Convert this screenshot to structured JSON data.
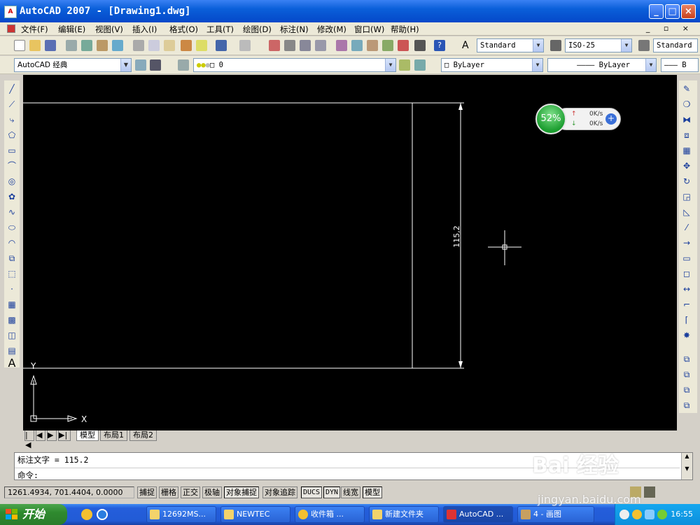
{
  "window": {
    "title": "AutoCAD 2007 - [Drawing1.dwg]",
    "app_icon": "A",
    "minimize": "_",
    "maximize": "□",
    "close": "×"
  },
  "menu": {
    "items": [
      "文件(F)",
      "编辑(E)",
      "视图(V)",
      "插入(I)",
      "格式(O)",
      "工具(T)",
      "绘图(D)",
      "标注(N)",
      "修改(M)",
      "窗口(W)",
      "帮助(H)"
    ],
    "mdi_controls": "_ ▫ ×"
  },
  "toolbar_styles": {
    "text_style": "Standard",
    "dim_style": "ISO-25",
    "table_style": "Standard"
  },
  "toolbar_layers": {
    "workspace": "AutoCAD 经典",
    "layer": "0",
    "color": "ByLayer",
    "linetype": "ByLayer",
    "lineweight": "B"
  },
  "drawing": {
    "dimension_text": "115,2",
    "ucs_x": "X",
    "ucs_y": "Y"
  },
  "layout_tabs": {
    "nav": [
      "|◀",
      "◀",
      "▶",
      "▶|"
    ],
    "tabs": [
      "模型",
      "布局1",
      "布局2"
    ],
    "active": "模型"
  },
  "command": {
    "history": "标注文字 = 115.2",
    "prompt": "命令:"
  },
  "status": {
    "coords": "1261.4934, 701.4404, 0.0000",
    "buttons": [
      {
        "label": "捕捉",
        "on": false
      },
      {
        "label": "栅格",
        "on": false
      },
      {
        "label": "正交",
        "on": false
      },
      {
        "label": "极轴",
        "on": false
      },
      {
        "label": "对象捕捉",
        "on": true
      },
      {
        "label": "对象追踪",
        "on": false
      },
      {
        "label": "DUCS",
        "on": true
      },
      {
        "label": "DYN",
        "on": true
      },
      {
        "label": "线宽",
        "on": false
      },
      {
        "label": "模型",
        "on": true
      }
    ]
  },
  "net_monitor": {
    "percent": "52%",
    "up": "0K/s",
    "down": "0K/s"
  },
  "taskbar": {
    "start": "开始",
    "items": [
      "12692MS...",
      "NEWTEC",
      "收件箱 ...",
      "新建文件夹",
      "AutoCAD ...",
      "4 - 画图"
    ],
    "active": "AutoCAD ...",
    "clock": "16:55"
  },
  "watermark": {
    "main": "Bai 经验",
    "sub": "jingyan.baidu.com"
  },
  "colors": {
    "title_blue": "#0a5fd9",
    "canvas": "#000000",
    "taskbar": "#245edb",
    "start_green": "#2f8a2f"
  }
}
